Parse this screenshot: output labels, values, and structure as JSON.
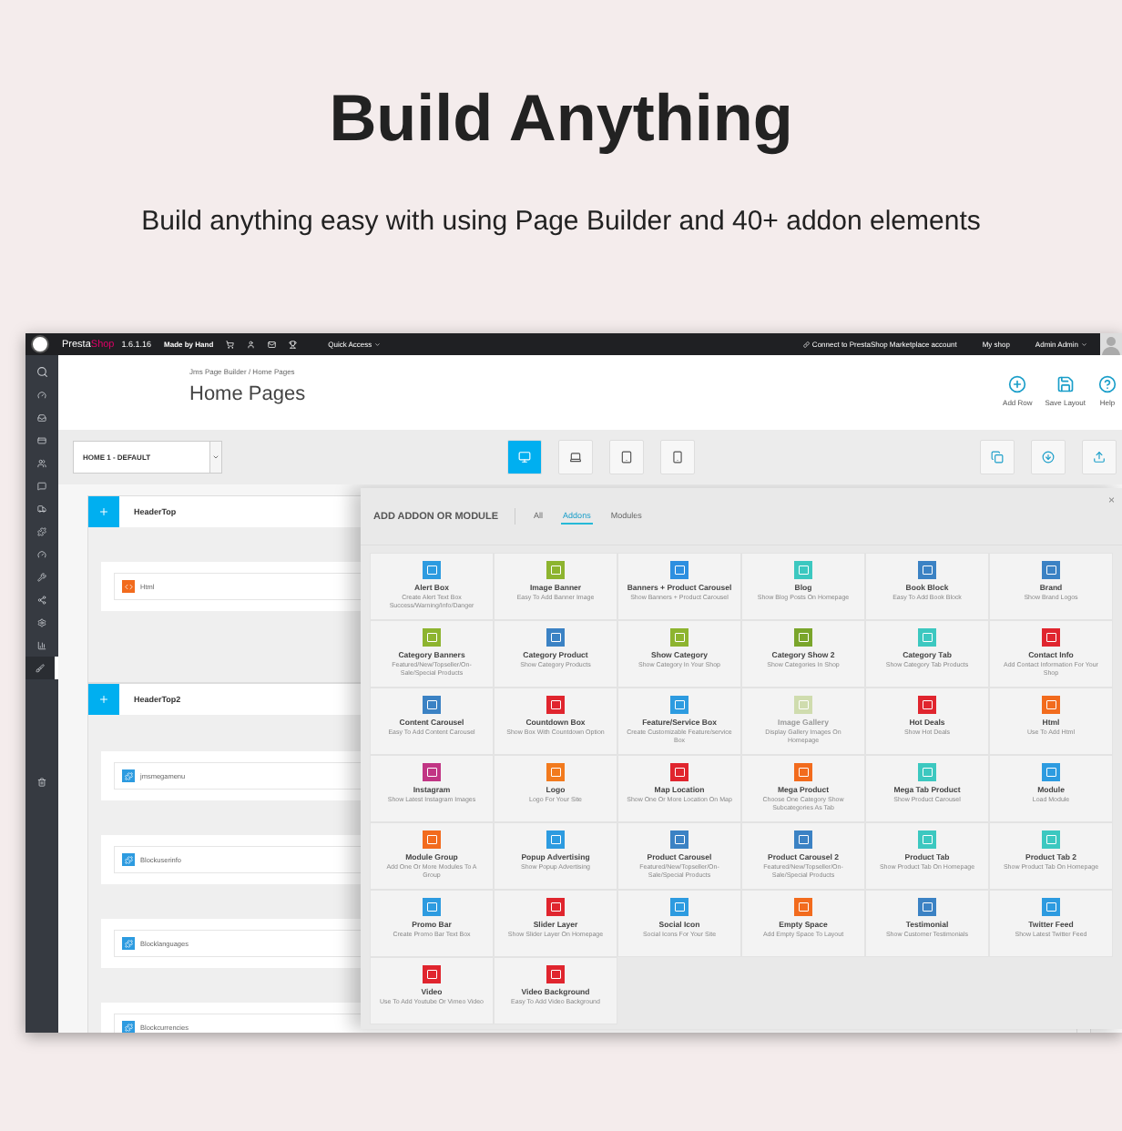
{
  "hero": {
    "title": "Build Anything",
    "subtitle": "Build anything easy with using Page Builder and 40+ addon elements"
  },
  "topbar": {
    "brand_1": "Presta",
    "brand_2": "Shop",
    "version": "1.6.1.16",
    "tagline": "Made by Hand",
    "quick_access": "Quick Access",
    "connect": "Connect to PrestaShop Marketplace account",
    "shop": "My shop",
    "user": "Admin Admin"
  },
  "nav": [
    {
      "kind": "dashboard",
      "selected": false
    },
    {
      "kind": "catalog",
      "selected": false
    },
    {
      "kind": "orders",
      "selected": false
    },
    {
      "kind": "customers",
      "selected": false
    },
    {
      "kind": "service",
      "selected": false
    },
    {
      "kind": "shipping",
      "selected": false
    },
    {
      "kind": "modules",
      "selected": false
    },
    {
      "kind": "stats",
      "selected": false
    },
    {
      "kind": "tools",
      "selected": false
    },
    {
      "kind": "share",
      "selected": false
    },
    {
      "kind": "settings",
      "selected": false
    },
    {
      "kind": "charts",
      "selected": false
    },
    {
      "kind": "builder",
      "selected": true
    }
  ],
  "header": {
    "breadcrumb": "Jms Page Builder  /  Home Pages",
    "title": "Home Pages",
    "actions": [
      {
        "label": "Add Row",
        "kind": "add"
      },
      {
        "label": "Save Layout",
        "kind": "save"
      },
      {
        "label": "Help",
        "kind": "help"
      }
    ]
  },
  "toolbar": {
    "layout_select": "HOME 1 - DEFAULT",
    "devices": [
      {
        "kind": "desktop",
        "selected": true
      },
      {
        "kind": "laptop",
        "selected": false
      },
      {
        "kind": "tablet",
        "selected": false
      },
      {
        "kind": "phone",
        "selected": false
      }
    ],
    "tools": [
      {
        "kind": "copy"
      },
      {
        "kind": "download"
      },
      {
        "kind": "upload"
      }
    ]
  },
  "rows": [
    {
      "title": "HeaderTop",
      "modules": [
        {
          "name": "Html",
          "kind": "html"
        }
      ]
    },
    {
      "title": "HeaderTop2",
      "modules": [
        {
          "name": "jmsmegamenu",
          "kind": "module"
        },
        {
          "name": "Blockuserinfo",
          "kind": "module"
        },
        {
          "name": "Blocklanguages",
          "kind": "module"
        },
        {
          "name": "Blockcurrencies",
          "kind": "module"
        }
      ]
    }
  ],
  "modal": {
    "title": "ADD ADDON OR MODULE",
    "close": "×",
    "tabs": [
      {
        "label": "All",
        "selected": false
      },
      {
        "label": "Addons",
        "selected": true
      },
      {
        "label": "Modules",
        "selected": false
      }
    ],
    "items": [
      {
        "title": "Alert Box",
        "desc": "Create Alert Text Box Success/Warning/Info/Danger",
        "color": "#2d9be0",
        "disabled": false
      },
      {
        "title": "Image Banner",
        "desc": "Easy To Add Banner Image",
        "color": "#8db42f",
        "disabled": false
      },
      {
        "title": "Banners + Product Carousel",
        "desc": "Show Banners + Product Carousel",
        "color": "#2d8fe0",
        "disabled": false
      },
      {
        "title": "Blog",
        "desc": "Show Blog Posts On Homepage",
        "color": "#3cc8c0",
        "disabled": false
      },
      {
        "title": "Book Block",
        "desc": "Easy To Add Book Block",
        "color": "#3b82c4",
        "disabled": false
      },
      {
        "title": "Brand",
        "desc": "Show Brand Logos",
        "color": "#3b82c4",
        "disabled": false
      },
      {
        "title": "Category Banners",
        "desc": "Featured/New/Topseller/On-Sale/Special Products",
        "color": "#8db42f",
        "disabled": false
      },
      {
        "title": "Category Product",
        "desc": "Show Category Products",
        "color": "#3b82c4",
        "disabled": false
      },
      {
        "title": "Show Category",
        "desc": "Show Category In Your Shop",
        "color": "#8db42f",
        "disabled": false
      },
      {
        "title": "Category Show 2",
        "desc": "Show Categories In Shop",
        "color": "#7aa52b",
        "disabled": false
      },
      {
        "title": "Category Tab",
        "desc": "Show Category Tab Products",
        "color": "#3cc8c0",
        "disabled": false
      },
      {
        "title": "Contact Info",
        "desc": "Add Contact Information For Your Shop",
        "color": "#e0252e",
        "disabled": false
      },
      {
        "title": "Content Carousel",
        "desc": "Easy To Add Content Carousel",
        "color": "#3b82c4",
        "disabled": false
      },
      {
        "title": "Countdown Box",
        "desc": "Show Box With Countdown Option",
        "color": "#e0252e",
        "disabled": false
      },
      {
        "title": "Feature/Service Box",
        "desc": "Create Customizable Feature/service Box",
        "color": "#2d9be0",
        "disabled": false
      },
      {
        "title": "Image Gallery",
        "desc": "Display Gallery Images On Homepage",
        "color": "#cfdcae",
        "disabled": true
      },
      {
        "title": "Hot Deals",
        "desc": "Show Hot Deals",
        "color": "#e0252e",
        "disabled": false
      },
      {
        "title": "Html",
        "desc": "Use To Add Html",
        "color": "#f26b1d",
        "disabled": false
      },
      {
        "title": "Instagram",
        "desc": "Show Latest Instagram Images",
        "color": "#c13584",
        "disabled": false
      },
      {
        "title": "Logo",
        "desc": "Logo For Your Site",
        "color": "#f27a1d",
        "disabled": false
      },
      {
        "title": "Map Location",
        "desc": "Show One Or More Location On Map",
        "color": "#e0252e",
        "disabled": false
      },
      {
        "title": "Mega Product",
        "desc": "Choose One Category Show Subcategories As Tab",
        "color": "#f26b1d",
        "disabled": false
      },
      {
        "title": "Mega Tab Product",
        "desc": "Show Product Carousel",
        "color": "#3cc8c0",
        "disabled": false
      },
      {
        "title": "Module",
        "desc": "Load Module",
        "color": "#2d9be0",
        "disabled": false
      },
      {
        "title": "Module Group",
        "desc": "Add One Or More Modules To A Group",
        "color": "#f26b1d",
        "disabled": false
      },
      {
        "title": "Popup Advertising",
        "desc": "Show Popup Advertising",
        "color": "#2d9be0",
        "disabled": false
      },
      {
        "title": "Product Carousel",
        "desc": "Featured/New/Topseller/On-Sale/Special Products",
        "color": "#3b82c4",
        "disabled": false
      },
      {
        "title": "Product Carousel 2",
        "desc": "Featured/New/Topseller/On-Sale/Special Products",
        "color": "#3b82c4",
        "disabled": false
      },
      {
        "title": "Product Tab",
        "desc": "Show Product Tab On Homepage",
        "color": "#3cc8c0",
        "disabled": false
      },
      {
        "title": "Product Tab 2",
        "desc": "Show Product Tab On Homepage",
        "color": "#3cc8c0",
        "disabled": false
      },
      {
        "title": "Promo Bar",
        "desc": "Create Promo Bar Text Box",
        "color": "#2d9be0",
        "disabled": false
      },
      {
        "title": "Slider Layer",
        "desc": "Show Slider Layer On Homepage",
        "color": "#e0252e",
        "disabled": false
      },
      {
        "title": "Social Icon",
        "desc": "Social Icons For Your Site",
        "color": "#2d9be0",
        "disabled": false
      },
      {
        "title": "Empty Space",
        "desc": "Add Empty Space To Layout",
        "color": "#f26b1d",
        "disabled": false
      },
      {
        "title": "Testimonial",
        "desc": "Show Customer Testimonials",
        "color": "#3b82c4",
        "disabled": false
      },
      {
        "title": "Twitter Feed",
        "desc": "Show Latest Twitter Feed",
        "color": "#2d9be0",
        "disabled": false
      },
      {
        "title": "Video",
        "desc": "Use To Add Youtube Or Vimeo Video",
        "color": "#e0252e",
        "disabled": false
      },
      {
        "title": "Video Background",
        "desc": "Easy To Add Video Background",
        "color": "#e0252e",
        "disabled": false
      }
    ]
  }
}
